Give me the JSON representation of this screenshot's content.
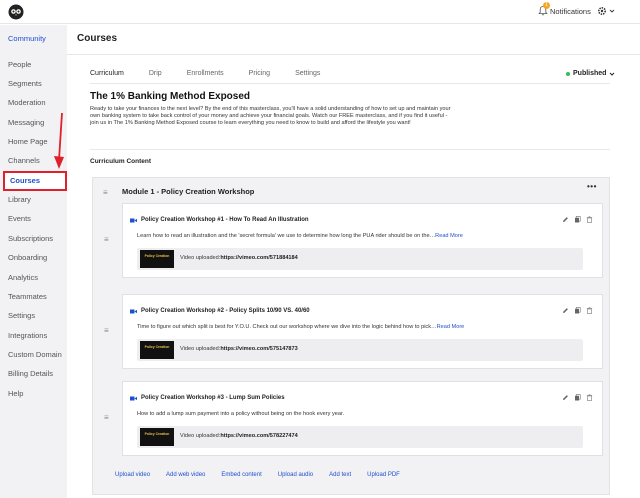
{
  "topbar": {
    "logo_icon": "owl-logo-icon",
    "notifications_label": "Notifications",
    "notifications_count": "1",
    "settings_icon": "gear-icon"
  },
  "sidebar": {
    "items": [
      {
        "label": "Community"
      },
      {
        "label": "People"
      },
      {
        "label": "Segments"
      },
      {
        "label": "Moderation"
      },
      {
        "label": "Messaging"
      },
      {
        "label": "Home Page"
      },
      {
        "label": "Channels"
      },
      {
        "label": "Courses"
      },
      {
        "label": "Library"
      },
      {
        "label": "Events"
      },
      {
        "label": "Subscriptions"
      },
      {
        "label": "Onboarding"
      },
      {
        "label": "Analytics"
      },
      {
        "label": "Teammates"
      },
      {
        "label": "Settings"
      },
      {
        "label": "Integrations"
      },
      {
        "label": "Custom Domain"
      },
      {
        "label": "Billing Details"
      },
      {
        "label": "Help"
      }
    ]
  },
  "page": {
    "title": "Courses",
    "tabs": [
      {
        "label": "Curriculum"
      },
      {
        "label": "Drip"
      },
      {
        "label": "Enrollments"
      },
      {
        "label": "Pricing"
      },
      {
        "label": "Settings"
      }
    ],
    "status": "Published",
    "status_color": "#2dbe60"
  },
  "course": {
    "title": "The 1% Banking Method Exposed",
    "description": "Ready to take your finances to the next level? By the end of this masterclass, you'll have a solid understanding of how to set up and maintain your own banking system to take back control of your money and achieve your financial goals. Watch our FREE masterclass, and if you find it useful - join us in The 1% Banking Method Exposed course to learn everything you need to know to build and afford the lifestyle you want!",
    "curriculum_label": "Curriculum Content"
  },
  "module": {
    "title": "Module 1 - Policy Creation Workshop",
    "more_label": "•••",
    "lessons": [
      {
        "title": "Policy Creation Workshop #1 - How To Read An Illustration",
        "description": "Learn how to read an illustration and the 'secret formula' we use to determine how long the PUA rider should be on the…",
        "read_more": "Read More",
        "thumb_text": "Policy Creation",
        "video_label": "Video uploaded:",
        "video_url": "https://vimeo.com/571884184"
      },
      {
        "title": "Policy Creation Workshop #2 - Policy Splits 10/90 VS. 40/60",
        "description": "Time to figure out which split is best for Y.O.U. Check out our workshop where we dive into the logic behind how to pick…",
        "read_more": "Read More",
        "thumb_text": "Policy Creation",
        "video_label": "Video uploaded:",
        "video_url": "https://vimeo.com/575147873"
      },
      {
        "title": "Policy Creation Workshop #3 - Lump Sum Policies",
        "description": "How to add a lump sum payment into a policy without being on the hook every year.",
        "read_more": "",
        "thumb_text": "Policy Creation",
        "video_label": "Video uploaded:",
        "video_url": "https://vimeo.com/578227474"
      }
    ],
    "upload_links": [
      {
        "label": "Upload video"
      },
      {
        "label": "Add web video"
      },
      {
        "label": "Embed content"
      },
      {
        "label": "Upload audio"
      },
      {
        "label": "Add text"
      },
      {
        "label": "Upload PDF"
      }
    ]
  },
  "colors": {
    "accent": "#1f4fcf",
    "highlight_box": "#e0202a"
  }
}
